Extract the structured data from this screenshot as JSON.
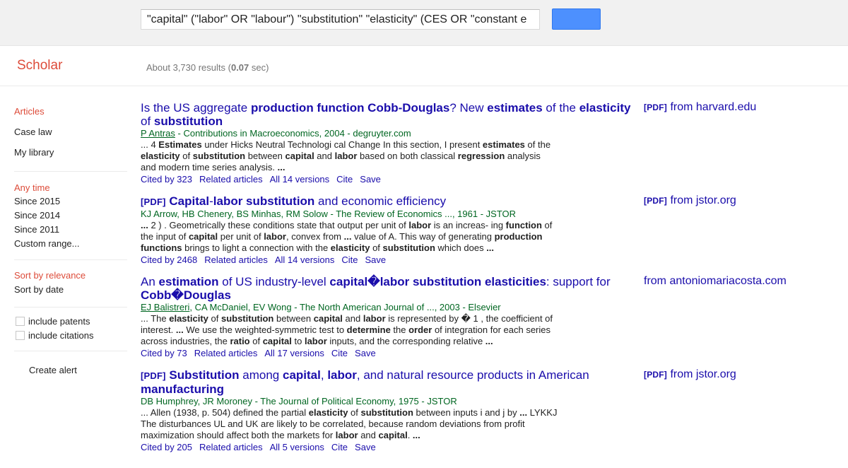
{
  "search": {
    "query": "\"capital\" (\"labor\" OR \"labour\") \"substitution\" \"elasticity\" (CES OR \"constant e"
  },
  "header": {
    "logo": "Scholar",
    "about": "About 3,730 results (",
    "time": "0.07",
    "time_unit": " sec)"
  },
  "sidebar": {
    "type_links": [
      "Articles",
      "Case law",
      "My library"
    ],
    "time_links": [
      "Any time",
      "Since 2015",
      "Since 2014",
      "Since 2011",
      "Custom range..."
    ],
    "sort_links": [
      "Sort by relevance",
      "Sort by date"
    ],
    "checkboxes": [
      "include patents",
      "include citations"
    ],
    "create_alert": "Create alert"
  },
  "results": [
    {
      "title": [
        {
          "t": "Is the US aggregate ",
          "b": false
        },
        {
          "t": "production function Cobb-Douglas",
          "b": true
        },
        {
          "t": "? New ",
          "b": false
        },
        {
          "t": "estimates",
          "b": true
        },
        {
          "t": " of the ",
          "b": false
        },
        {
          "t": "elasticity",
          "b": true
        },
        {
          "t": " of ",
          "b": false
        },
        {
          "t": "substitution",
          "b": true
        }
      ],
      "meta_author": "P Antras",
      "meta_rest": " - Contributions in Macroeconomics, 2004 - degruyter.com",
      "snippet": [
        {
          "t": "... 4 ",
          "b": false
        },
        {
          "t": "Estimates",
          "b": true
        },
        {
          "t": " under Hicks Neutral Technologi cal Change In this section, I present ",
          "b": false
        },
        {
          "t": "estimates",
          "b": true
        },
        {
          "t": " of the ",
          "b": false
        },
        {
          "t": "elasticity",
          "b": true
        },
        {
          "t": " of ",
          "b": false
        },
        {
          "t": "substitution",
          "b": true
        },
        {
          "t": " between ",
          "b": false
        },
        {
          "t": "capital",
          "b": true
        },
        {
          "t": " and ",
          "b": false
        },
        {
          "t": "labor",
          "b": true
        },
        {
          "t": " based on both classical ",
          "b": false
        },
        {
          "t": "regression",
          "b": true
        },
        {
          "t": " analysis and modern time series analysis. ",
          "b": false
        },
        {
          "t": "...",
          "b": true
        }
      ],
      "links": [
        "Cited by 323",
        "Related articles",
        "All 14 versions",
        "Cite",
        "Save"
      ],
      "pdf_source": "from harvard.edu"
    },
    {
      "tag": "[PDF]",
      "title": [
        {
          "t": "Capital",
          "b": true
        },
        {
          "t": "-",
          "b": false
        },
        {
          "t": "labor substitution",
          "b": true
        },
        {
          "t": " and economic efficiency",
          "b": false
        }
      ],
      "meta_author": "",
      "meta_rest": "KJ Arrow, HB Chenery, BS Minhas, RM Solow - The Review of Economics ..., 1961 - JSTOR",
      "snippet": [
        {
          "t": "... ",
          "b": true
        },
        {
          "t": "2 ) . Geometrically these conditions state that output per unit of ",
          "b": false
        },
        {
          "t": "labor",
          "b": true
        },
        {
          "t": " is an increas- ing ",
          "b": false
        },
        {
          "t": "function",
          "b": true
        },
        {
          "t": " of the input of ",
          "b": false
        },
        {
          "t": "capital",
          "b": true
        },
        {
          "t": " per unit of ",
          "b": false
        },
        {
          "t": "labor",
          "b": true
        },
        {
          "t": ", convex from ",
          "b": false
        },
        {
          "t": "...",
          "b": true
        },
        {
          "t": " value of A. This way of generating ",
          "b": false
        },
        {
          "t": "production functions",
          "b": true
        },
        {
          "t": " brings to light a connection with the ",
          "b": false
        },
        {
          "t": "elasticity",
          "b": true
        },
        {
          "t": " of ",
          "b": false
        },
        {
          "t": "substitution",
          "b": true
        },
        {
          "t": " which does ",
          "b": false
        },
        {
          "t": "...",
          "b": true
        }
      ],
      "links": [
        "Cited by 2468",
        "Related articles",
        "All 14 versions",
        "Cite",
        "Save"
      ],
      "pdf_source": "from jstor.org"
    },
    {
      "title": [
        {
          "t": "An ",
          "b": false
        },
        {
          "t": "estimation",
          "b": true
        },
        {
          "t": " of US industry-level ",
          "b": false
        },
        {
          "t": "capital�labor substitution elasticities",
          "b": true
        },
        {
          "t": ": support for ",
          "b": false
        },
        {
          "t": "Cobb�Douglas",
          "b": true
        }
      ],
      "meta_author": "EJ Balistreri",
      "meta_rest": ", CA McDaniel, EV Wong - The North American Journal of ..., 2003 - Elsevier",
      "snippet": [
        {
          "t": "... The ",
          "b": false
        },
        {
          "t": "elasticity",
          "b": true
        },
        {
          "t": " of ",
          "b": false
        },
        {
          "t": "substitution",
          "b": true
        },
        {
          "t": " between ",
          "b": false
        },
        {
          "t": "capital",
          "b": true
        },
        {
          "t": " and ",
          "b": false
        },
        {
          "t": "labor",
          "b": true
        },
        {
          "t": " is represented by � 1 , the coefficient of interest. ",
          "b": false
        },
        {
          "t": "...",
          "b": true
        },
        {
          "t": " We use the weighted-symmetric test to ",
          "b": false
        },
        {
          "t": "determine",
          "b": true
        },
        {
          "t": " the ",
          "b": false
        },
        {
          "t": "order",
          "b": true
        },
        {
          "t": " of integration for each series across industries, the ",
          "b": false
        },
        {
          "t": "ratio",
          "b": true
        },
        {
          "t": " of ",
          "b": false
        },
        {
          "t": "capital",
          "b": true
        },
        {
          "t": " to ",
          "b": false
        },
        {
          "t": "labor",
          "b": true
        },
        {
          "t": " inputs, and the corresponding relative ",
          "b": false
        },
        {
          "t": "...",
          "b": true
        }
      ],
      "links": [
        "Cited by 73",
        "Related articles",
        "All 17 versions",
        "Cite",
        "Save"
      ],
      "pdf_source": "from antoniomariacosta.com"
    },
    {
      "tag": "[PDF]",
      "title": [
        {
          "t": "Substitution",
          "b": true
        },
        {
          "t": " among ",
          "b": false
        },
        {
          "t": "capital",
          "b": true
        },
        {
          "t": ", ",
          "b": false
        },
        {
          "t": "labor",
          "b": true
        },
        {
          "t": ", and natural resource products in American ",
          "b": false
        },
        {
          "t": "manufacturing",
          "b": true
        }
      ],
      "meta_author": "",
      "meta_rest": "DB Humphrey, JR Moroney - The Journal of Political Economy, 1975 - JSTOR",
      "snippet": [
        {
          "t": "... Allen (1938, p. 504) defined the partial ",
          "b": false
        },
        {
          "t": "elasticity",
          "b": true
        },
        {
          "t": " of ",
          "b": false
        },
        {
          "t": "substitution",
          "b": true
        },
        {
          "t": " between inputs i and j by ",
          "b": false
        },
        {
          "t": "...",
          "b": true
        },
        {
          "t": " LYKKJ The disturbances UL and UK are likely to be correlated, because random deviations from profit maximization should affect both the markets for ",
          "b": false
        },
        {
          "t": "labor",
          "b": true
        },
        {
          "t": " and ",
          "b": false
        },
        {
          "t": "capital",
          "b": true
        },
        {
          "t": ". ",
          "b": false
        },
        {
          "t": "...",
          "b": true
        }
      ],
      "links": [
        "Cited by 205",
        "Related articles",
        "All 5 versions",
        "Cite",
        "Save"
      ],
      "pdf_source": "from jstor.org"
    }
  ],
  "pdf_tag": "[PDF]"
}
